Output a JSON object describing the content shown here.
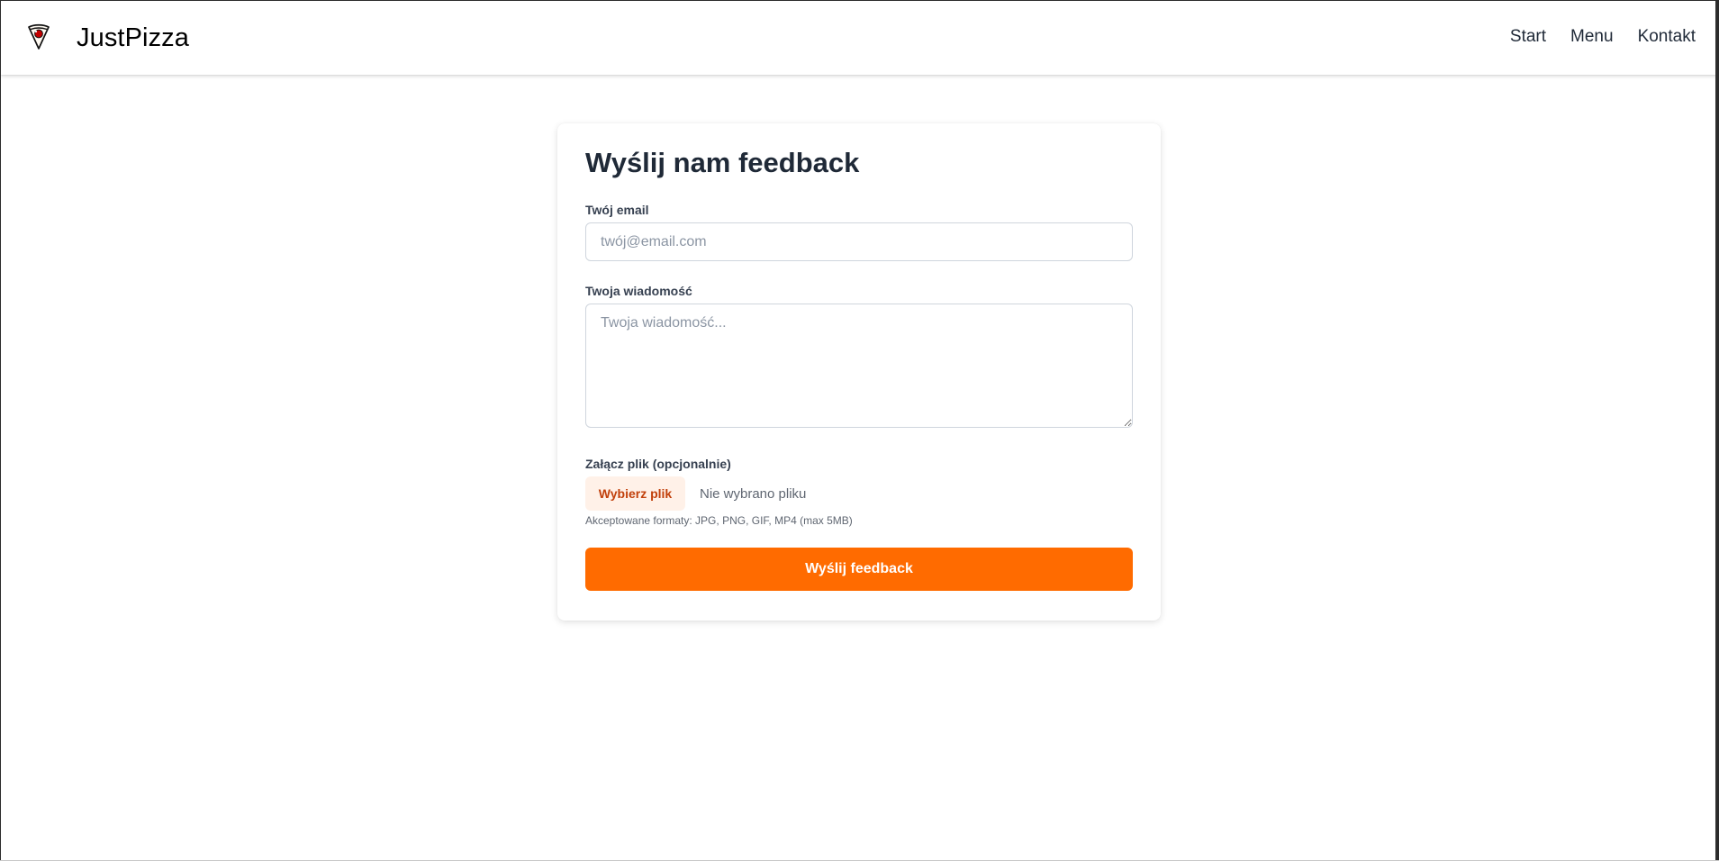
{
  "header": {
    "brand": "JustPizza",
    "logo_icon": "pizza-icon",
    "nav": [
      {
        "label": "Start"
      },
      {
        "label": "Menu"
      },
      {
        "label": "Kontakt"
      }
    ]
  },
  "form": {
    "title": "Wyślij nam feedback",
    "email_label": "Twój email",
    "email_placeholder": "twój@email.com",
    "email_value": "",
    "message_label": "Twoja wiadomość",
    "message_placeholder": "Twoja wiadomość...",
    "message_value": "",
    "file_label": "Załącz plik (opcjonalnie)",
    "file_button": "Wybierz plik",
    "file_status": "Nie wybrano pliku",
    "file_hint": "Akceptowane formaty: JPG, PNG, GIF, MP4 (max 5MB)",
    "submit_label": "Wyślij feedback"
  },
  "colors": {
    "accent": "#ff6b00",
    "file_button_background": "#fff1e8",
    "file_button_text": "#c2410c",
    "heading_text": "#1f2937",
    "muted_text": "#5f6671"
  }
}
